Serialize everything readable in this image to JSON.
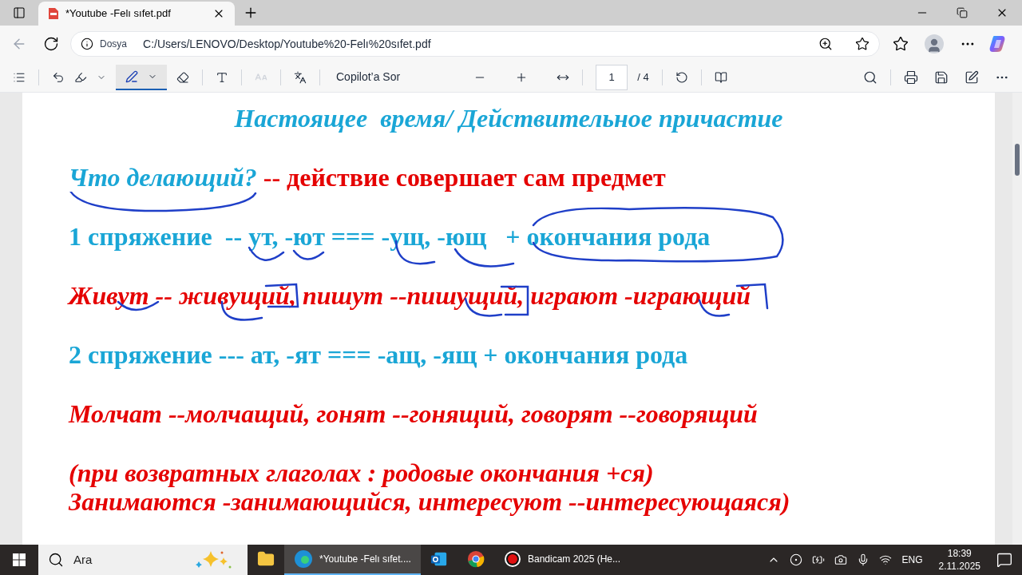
{
  "browser_tab": {
    "title": "*Youtube -Felı sıfet.pdf"
  },
  "address_bar": {
    "scheme_label": "Dosya",
    "url": "C:/Users/LENOVO/Desktop/Youtube%20-Felı%20sıfet.pdf"
  },
  "pdf_toolbar": {
    "draw_selected": true,
    "read_aloud_disabled": true,
    "copilot_label": "Copilot’a Sor",
    "page": "1",
    "page_total": "/ 4"
  },
  "document": {
    "lines": [
      {
        "kind": "title",
        "segments": [
          {
            "text": "Настоящее  время/ Действительное причастие",
            "color": "#1aa6d6",
            "italic": true
          }
        ]
      },
      {
        "kind": "paragraph",
        "segments": [
          {
            "text": "Что делающий?",
            "color": "#1aa6d6",
            "italic": true
          },
          {
            "text": " -- действие совершает сам предмет",
            "color": "#e50000",
            "italic": false
          }
        ]
      },
      {
        "kind": "paragraph",
        "segments": [
          {
            "text": "1 спряжение  -- ут, -ют === -ущ, -ющ   + окончания рода",
            "color": "#1aa6d6",
            "italic": false
          }
        ]
      },
      {
        "kind": "paragraph",
        "segments": [
          {
            "text": "Живут -- живущий, пишут --пишущий, играют -играющий",
            "color": "#e50000",
            "italic": true
          }
        ]
      },
      {
        "kind": "paragraph",
        "segments": [
          {
            "text": "2 спряжение --- ат, -ят === -ащ, -ящ + окончания рода",
            "color": "#1aa6d6",
            "italic": false
          }
        ]
      },
      {
        "kind": "paragraph",
        "segments": [
          {
            "text": "Молчат --молчащий, гонят --гонящий, говорят --говорящий",
            "color": "#e50000",
            "italic": true
          }
        ]
      },
      {
        "kind": "paragraph",
        "segments": [
          {
            "text": "(при возвратных глаголах : родовые окончания +ся)",
            "color": "#e50000",
            "italic": true
          }
        ]
      },
      {
        "kind": "continuation",
        "segments": [
          {
            "text": "Занимаются -занимающийся, интересуют --интересующаяся)",
            "color": "#e50000",
            "italic": true
          }
        ]
      }
    ]
  },
  "taskbar": {
    "search": {
      "placeholder": "Ara"
    },
    "apps": [
      {
        "kind": "explorer",
        "selected": false
      },
      {
        "kind": "edge",
        "title": "*Youtube -Felı sıfet....",
        "selected": true
      },
      {
        "kind": "outlook",
        "selected": false
      },
      {
        "kind": "chrome",
        "selected": false
      },
      {
        "kind": "bandicam",
        "title": "Bandicam 2025 (He...",
        "selected": false
      }
    ],
    "language": "ENG",
    "time": "18:39",
    "date": "2.11.2025"
  }
}
